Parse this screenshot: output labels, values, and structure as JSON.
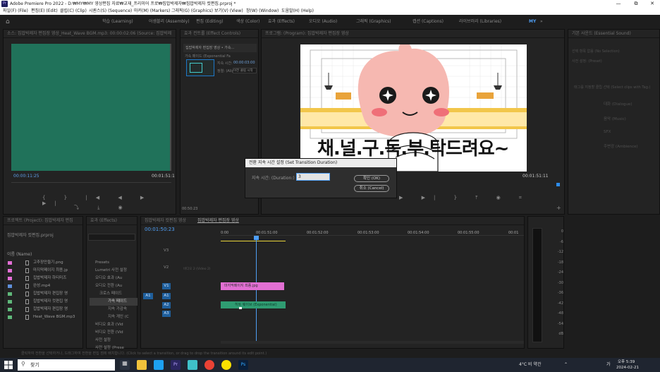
{
  "window": {
    "title": "Adobe Premiere Pro 2022 - D:₩MY₩MY 영상편집 자료₩교재_프리미어 프로₩집밥박제자₩집밥박제자 컷편집.prproj *",
    "app_icon_label": "Pr"
  },
  "menu": [
    "파일(F) (File)",
    "편집(E) (Edit)",
    "클립(C) (Clip)",
    "시퀀스(S) (Sequence)",
    "마커(M) (Markers)",
    "그래픽(G) (Graphics)",
    "보기(V) (View)",
    "창(W) (Window)",
    "도움말(H) (Help)"
  ],
  "workspaces": [
    "학습 (Learning)",
    "어셈블리 (Assembly)",
    "편집 (Editing)",
    "색상 (Color)",
    "효과 (Effects)",
    "오디오 (Audio)",
    "그래픽 (Graphics)",
    "캡션 (Captions)",
    "라이브러리 (Libraries)"
  ],
  "workspace_active": "MY",
  "source_monitor": {
    "tab": "소스: 집밥박제자 편집장 영상_Heat_Wave BGM.mp3: 00:00:02:06 (Source: 집밥박제",
    "timecode_left": "00:00:11:25",
    "timecode_right": "00:01:51:1"
  },
  "effect_controls": {
    "tab": "효과 컨트롤 (Effect Controls)",
    "clip_name": "집밥박제자 편집장 영상 • 가속...",
    "transition_name": "가속 페이드 (Exponential Fa",
    "duration_label": "지속 시간:",
    "duration_value": "00:00:03:00",
    "align_label": "정렬: (Alig",
    "align_value": "이전 클립 시작",
    "timecode": "00:50:23"
  },
  "program_monitor": {
    "tab": "프로그램: (Program): 집밥박제자 편집장 영상",
    "overlay_text": "채.널.구.독.부.탁드려요~",
    "timecode_right": "00:01:51:11"
  },
  "essential_sound": {
    "tab": "기본 사운드 (Essential Sound)",
    "no_selection": "선택 항목 없음 (No Selection)",
    "preset_label": "사전 설정: (Preset)",
    "hint": "태그를 지정할 클립 선택 (Select clips with Tag.)",
    "types": [
      "대화 (Dialogue)",
      "음악 (Music)",
      "SFX",
      "주변광 (Ambience)"
    ]
  },
  "project": {
    "tab": "프로젝트 (Project): 집밥박제자 편집",
    "file": "집밥박제자 컷편집.prproj",
    "column": "이름 (Name)",
    "items": [
      {
        "name": "고추장만들기.png",
        "color": "#e36fd6"
      },
      {
        "name": "마지막페이지 최종.jp",
        "color": "#e36fd6"
      },
      {
        "name": "집밥박제자 하티미즈",
        "color": "#e36fd6"
      },
      {
        "name": "완성.mp4",
        "color": "#5f8fd9"
      },
      {
        "name": "집밥박제자 편집장 영",
        "color": "#5fb87a"
      },
      {
        "name": "집밥박제자 컷편집 영",
        "color": "#5fb87a"
      },
      {
        "name": "집밥박제자 편집장 영",
        "color": "#5fb87a"
      },
      {
        "name": "Heat_Wave BGM.mp3",
        "color": "#5fb87a"
      }
    ]
  },
  "effects_panel": {
    "tab": "효과 (Effects)",
    "tree": [
      "Presets",
      "Lumetri 사전 설정",
      "오디오 효과 (Au",
      "오디오 전환 (Au",
      "크로스 페이드",
      "가속 페이드",
      "지속 가감속",
      "지속 게인 (C",
      "비디오 효과 (Vid",
      "비디오 전환 (Vid",
      "사전 설정",
      "사전 설정 (Prese"
    ]
  },
  "timeline": {
    "tabs": [
      "집밥박제자 컷편집 영상",
      "집밥박제자 편집장 영상"
    ],
    "timecode": "00:01:50:23",
    "ruler": [
      "0:00",
      "00:01:51:00",
      "00:01:52:00",
      "00:01:53:00",
      "00:01:54:00",
      "00:01:55:00",
      "00:01"
    ],
    "tracks": [
      "V3",
      "V2",
      "V1",
      "A1",
      "A2",
      "A3"
    ],
    "v2_label": "비디오 2 (Video 2)",
    "clip_v1": "마지막페이지 최종.jpg",
    "clip_a2": "히트 웨이브 (Exponential)"
  },
  "meters": {
    "scale": [
      "0",
      "-6",
      "-12",
      "-18",
      "-24",
      "-30",
      "-36",
      "-42",
      "-48",
      "-54",
      "dB"
    ]
  },
  "status": "클릭하여 전환을 선택하거나, 드래그하여 전환을 편집 점에 배치합니다. (Click to select a transition, or drag to drop the transition around its edit point.)",
  "dialog": {
    "title": "전환 지속 시간 설정 (Set Transition Duration)",
    "label": "지속 시간: (Duration:)",
    "value": "3",
    "ok": "확인 (OK)",
    "cancel": "취소 (Cancel)"
  },
  "taskbar": {
    "search_placeholder": "찾기",
    "weather": "4°C 비 약간",
    "ime": "가",
    "time": "오후 5:39",
    "date": "2024-02-21"
  }
}
